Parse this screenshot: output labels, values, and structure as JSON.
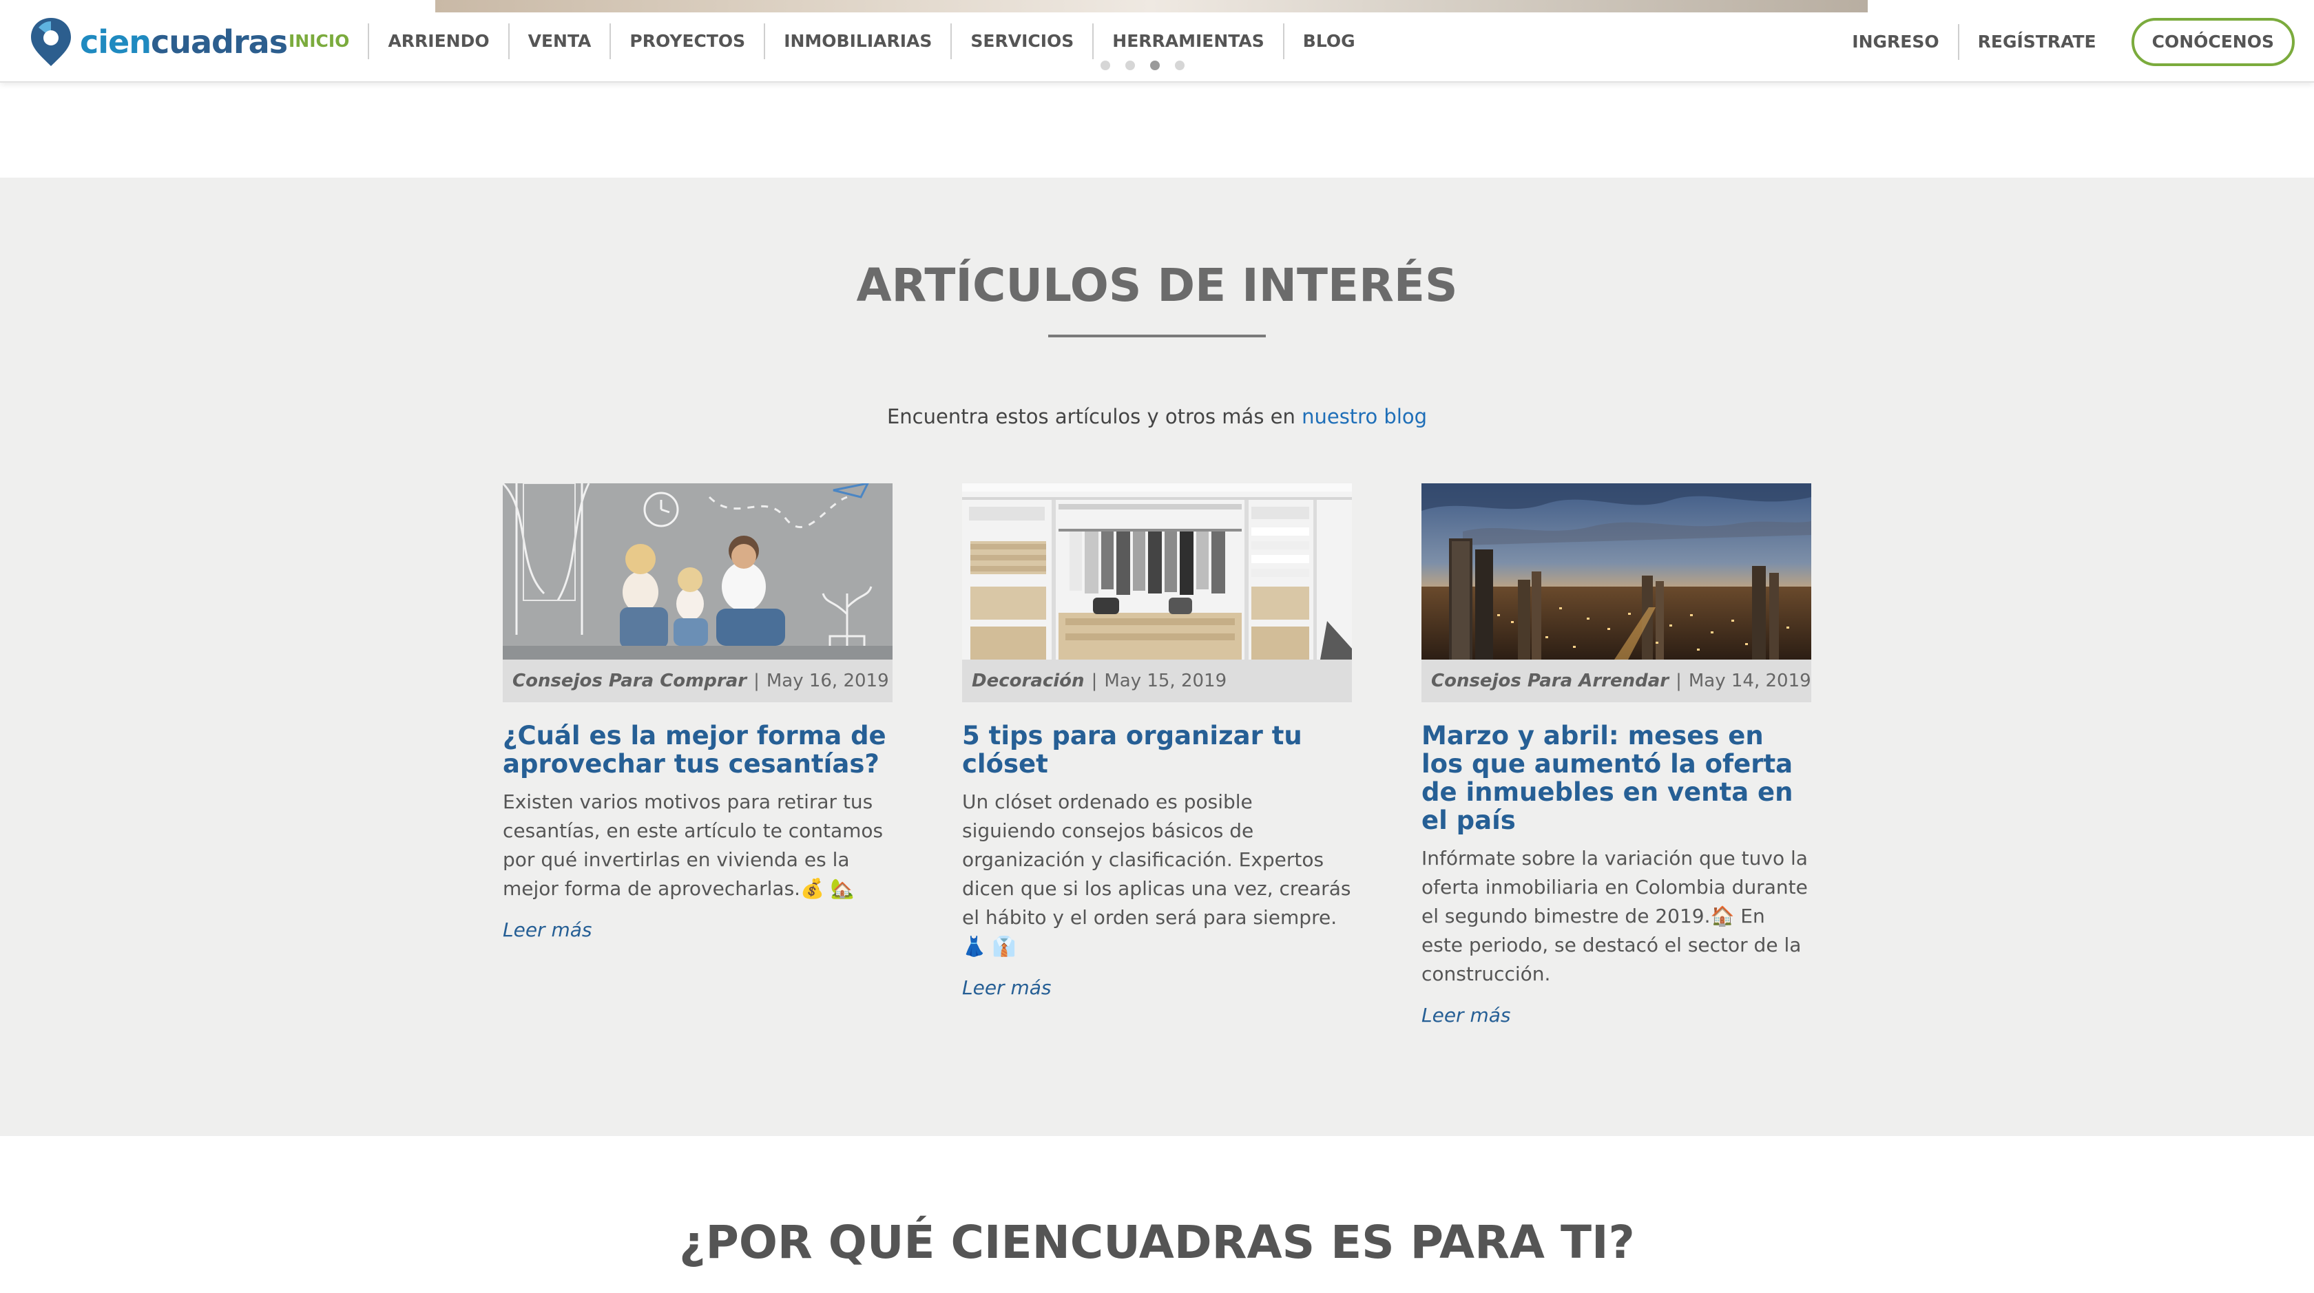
{
  "header": {
    "logo_text_a": "cien",
    "logo_text_b": "cuadras",
    "nav": [
      "INICIO",
      "ARRIENDO",
      "VENTA",
      "PROYECTOS",
      "INMOBILIARIAS",
      "SERVICIOS",
      "HERRAMIENTAS",
      "BLOG"
    ],
    "active_nav": "INICIO",
    "login_label": "INGRESO",
    "register_label": "REGÍSTRATE",
    "about_button_label": "CONÓCENOS",
    "carousel_slide_count": 4,
    "carousel_active_index": 3
  },
  "articles_section": {
    "title": "ARTÍCULOS DE INTERÉS",
    "intro_text": "Encuentra estos artículos y otros más en",
    "intro_link": "nuestro blog",
    "cards": [
      {
        "image": "family-sitting-drawn-house-photo",
        "category": "Consejos Para Comprar",
        "date": "May 16, 2019",
        "title": "¿Cuál es la mejor forma de aprovechar tus cesantías?",
        "excerpt": "Existen varios motivos para retirar tus cesantías, en este artículo te contamos por qué invertirlas en vivienda es la mejor forma de aprovecharlas.💰 🏡",
        "read_more": "Leer más"
      },
      {
        "image": "organized-closet-photo",
        "category": "Decoración",
        "date": "May 15, 2019",
        "title": "5 tips para organizar tu clóset",
        "excerpt": "Un clóset ordenado es posible siguiendo consejos básicos de organización y clasificación. Expertos dicen que si los aplicas una vez, crearás el hábito y el orden será para siempre. 👗 👔",
        "read_more": "Leer más"
      },
      {
        "image": "city-skyline-sunset-photo",
        "category": "Consejos Para Arrendar",
        "date": "May 14, 2019",
        "title": "Marzo y abril: meses en los que aumentó la oferta de inmuebles en venta en el país",
        "excerpt": "Infórmate sobre la variación que tuvo la oferta inmobiliaria en Colombia durante el segundo bimestre de 2019.🏠 En este periodo, se destacó el sector de la construcción.",
        "read_more": "Leer más"
      }
    ]
  },
  "why_section": {
    "title": "¿POR QUÉ CIENCUADRAS ES PARA TI?"
  },
  "colors": {
    "brand_blue": "#265f95",
    "accent_green": "#7bab3d",
    "link_blue": "#1f6fb8",
    "section_bg": "#efefee"
  }
}
